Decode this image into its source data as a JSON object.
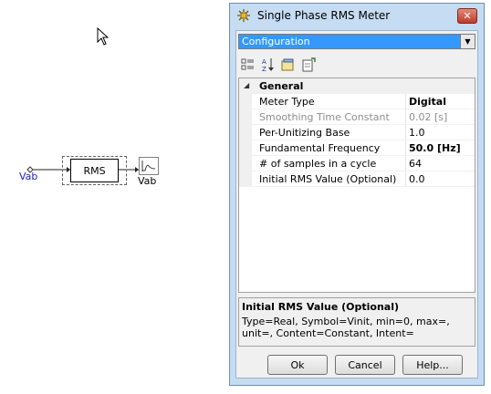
{
  "canvas": {
    "rms_block_label": "RMS",
    "input_label": "Vab",
    "output_label": "Vab"
  },
  "dialog": {
    "title": "Single Phase RMS Meter",
    "category_selector": "Configuration",
    "toolbar": {
      "categorized_icon": "categorized-view-icon",
      "alphabetical_icon": "alphabetical-sort-icon",
      "properties_icon": "property-pages-icon",
      "export_icon": "export-icon"
    },
    "grid": {
      "category": "General",
      "properties": [
        {
          "name": "Meter Type",
          "value": "Digital",
          "bold": true,
          "disabled": false
        },
        {
          "name": "Smoothing Time Constant",
          "value": "0.02 [s]",
          "bold": false,
          "disabled": true
        },
        {
          "name": "Per-Unitizing Base",
          "value": "1.0",
          "bold": false,
          "disabled": false
        },
        {
          "name": "Fundamental Frequency",
          "value": "50.0 [Hz]",
          "bold": true,
          "disabled": false
        },
        {
          "name": "# of samples in a cycle",
          "value": "64",
          "bold": false,
          "disabled": false
        },
        {
          "name": "Initial RMS Value (Optional)",
          "value": "0.0",
          "bold": false,
          "disabled": false
        }
      ]
    },
    "help": {
      "title": "Initial RMS Value (Optional)",
      "description": "Type=Real, Symbol=Vinit, min=0, max=, unit=, Content=Constant, Intent="
    },
    "buttons": {
      "ok": "Ok",
      "cancel": "Cancel",
      "help": "Help..."
    }
  }
}
